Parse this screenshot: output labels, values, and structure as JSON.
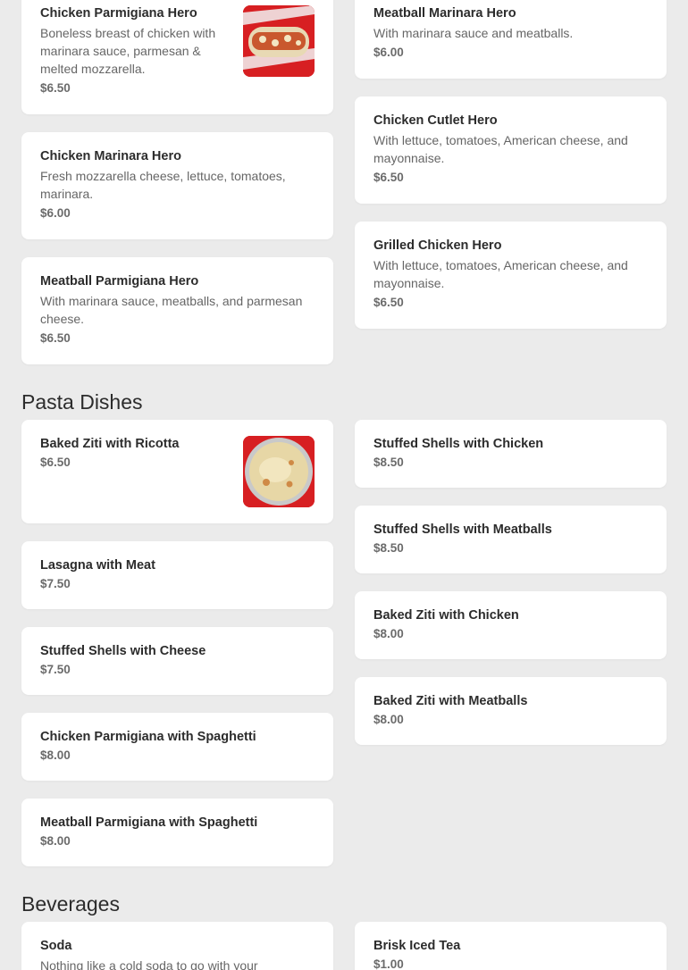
{
  "sections": {
    "pasta_title": "Pasta Dishes",
    "beverages_title": "Beverages"
  },
  "heroes": [
    {
      "name": "Chicken Parmigiana Hero",
      "desc": "Boneless breast of chicken with marinara sauce, parmesan & melted mozzarella.",
      "price": "$6.50",
      "image": "hero-sandwich-image"
    },
    {
      "name": "Meatball Marinara Hero",
      "desc": "With marinara sauce and meatballs.",
      "price": "$6.00"
    },
    {
      "name": "Chicken Marinara Hero",
      "desc": "Fresh mozzarella cheese, lettuce, tomatoes, marinara.",
      "price": "$6.00"
    },
    {
      "name": "Chicken Cutlet Hero",
      "desc": "With lettuce, tomatoes, American cheese, and mayonnaise.",
      "price": "$6.50"
    },
    {
      "name": "Meatball Parmigiana Hero",
      "desc": "With marinara sauce, meatballs, and parmesan cheese.",
      "price": "$6.50"
    },
    {
      "name": "Grilled Chicken Hero",
      "desc": "With lettuce, tomatoes, American cheese, and mayonnaise.",
      "price": "$6.50"
    }
  ],
  "pasta": [
    {
      "name": "Baked Ziti with Ricotta",
      "price": "$6.50",
      "image": "baked-ziti-image"
    },
    {
      "name": "Stuffed Shells with Chicken",
      "price": "$8.50"
    },
    {
      "name": "Lasagna with Meat",
      "price": "$7.50"
    },
    {
      "name": "Stuffed Shells with Meatballs",
      "price": "$8.50"
    },
    {
      "name": "Stuffed Shells with Cheese",
      "price": "$7.50"
    },
    {
      "name": "Baked Ziti with Chicken",
      "price": "$8.00"
    },
    {
      "name": "Chicken Parmigiana with Spaghetti",
      "price": "$8.00"
    },
    {
      "name": "Baked Ziti with Meatballs",
      "price": "$8.00"
    },
    {
      "name": "Meatball Parmigiana with Spaghetti",
      "price": "$8.00"
    }
  ],
  "beverages": [
    {
      "name": "Soda",
      "desc": "Nothing like a cold soda to go with your"
    },
    {
      "name": "Brisk Iced Tea",
      "price": "$1.00"
    }
  ]
}
